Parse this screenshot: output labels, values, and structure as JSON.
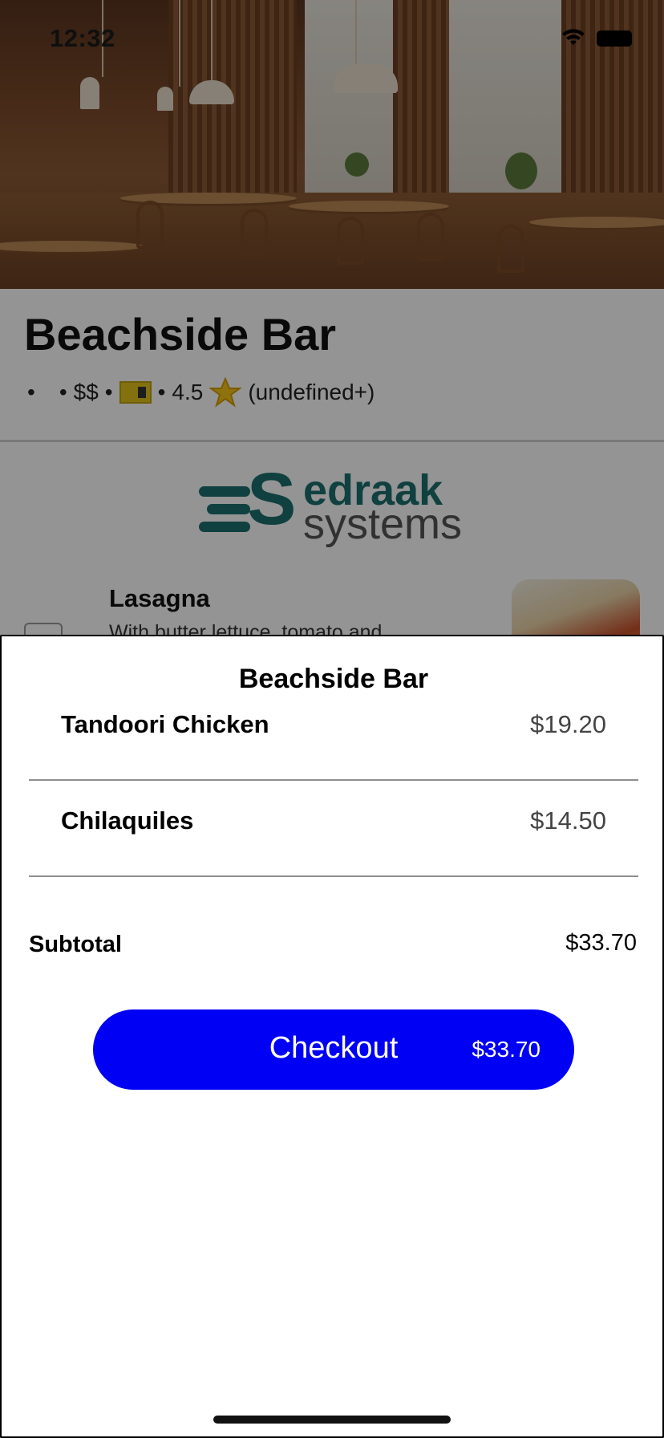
{
  "status_bar": {
    "time": "12:32"
  },
  "restaurant": {
    "name": "Beachside Bar",
    "meta": {
      "dot1": "•",
      "dot2": "•",
      "price_level": "$$",
      "dot3": "•",
      "dot4": "•",
      "rating": "4.5",
      "reviews": "(undefined+)"
    }
  },
  "logo": {
    "s": "S",
    "word1": "edraak",
    "word2": "systems"
  },
  "menu_item": {
    "title": "Lasagna",
    "description": "With butter lettuce, tomato and"
  },
  "cart": {
    "title": "Beachside Bar",
    "items": [
      {
        "name": "Tandoori Chicken",
        "price": "$19.20"
      },
      {
        "name": "Chilaquiles",
        "price": "$14.50"
      }
    ],
    "subtotal_label": "Subtotal",
    "subtotal_value": "$33.70",
    "checkout_label": "Checkout",
    "checkout_amount": "$33.70"
  },
  "colors": {
    "checkout_button": "#0000f5",
    "overlay": "rgba(0,0,0,0.42)",
    "logo_teal": "#1c6f6f"
  },
  "icons": [
    "wifi-icon",
    "battery-icon",
    "ticket-icon",
    "star-icon"
  ]
}
